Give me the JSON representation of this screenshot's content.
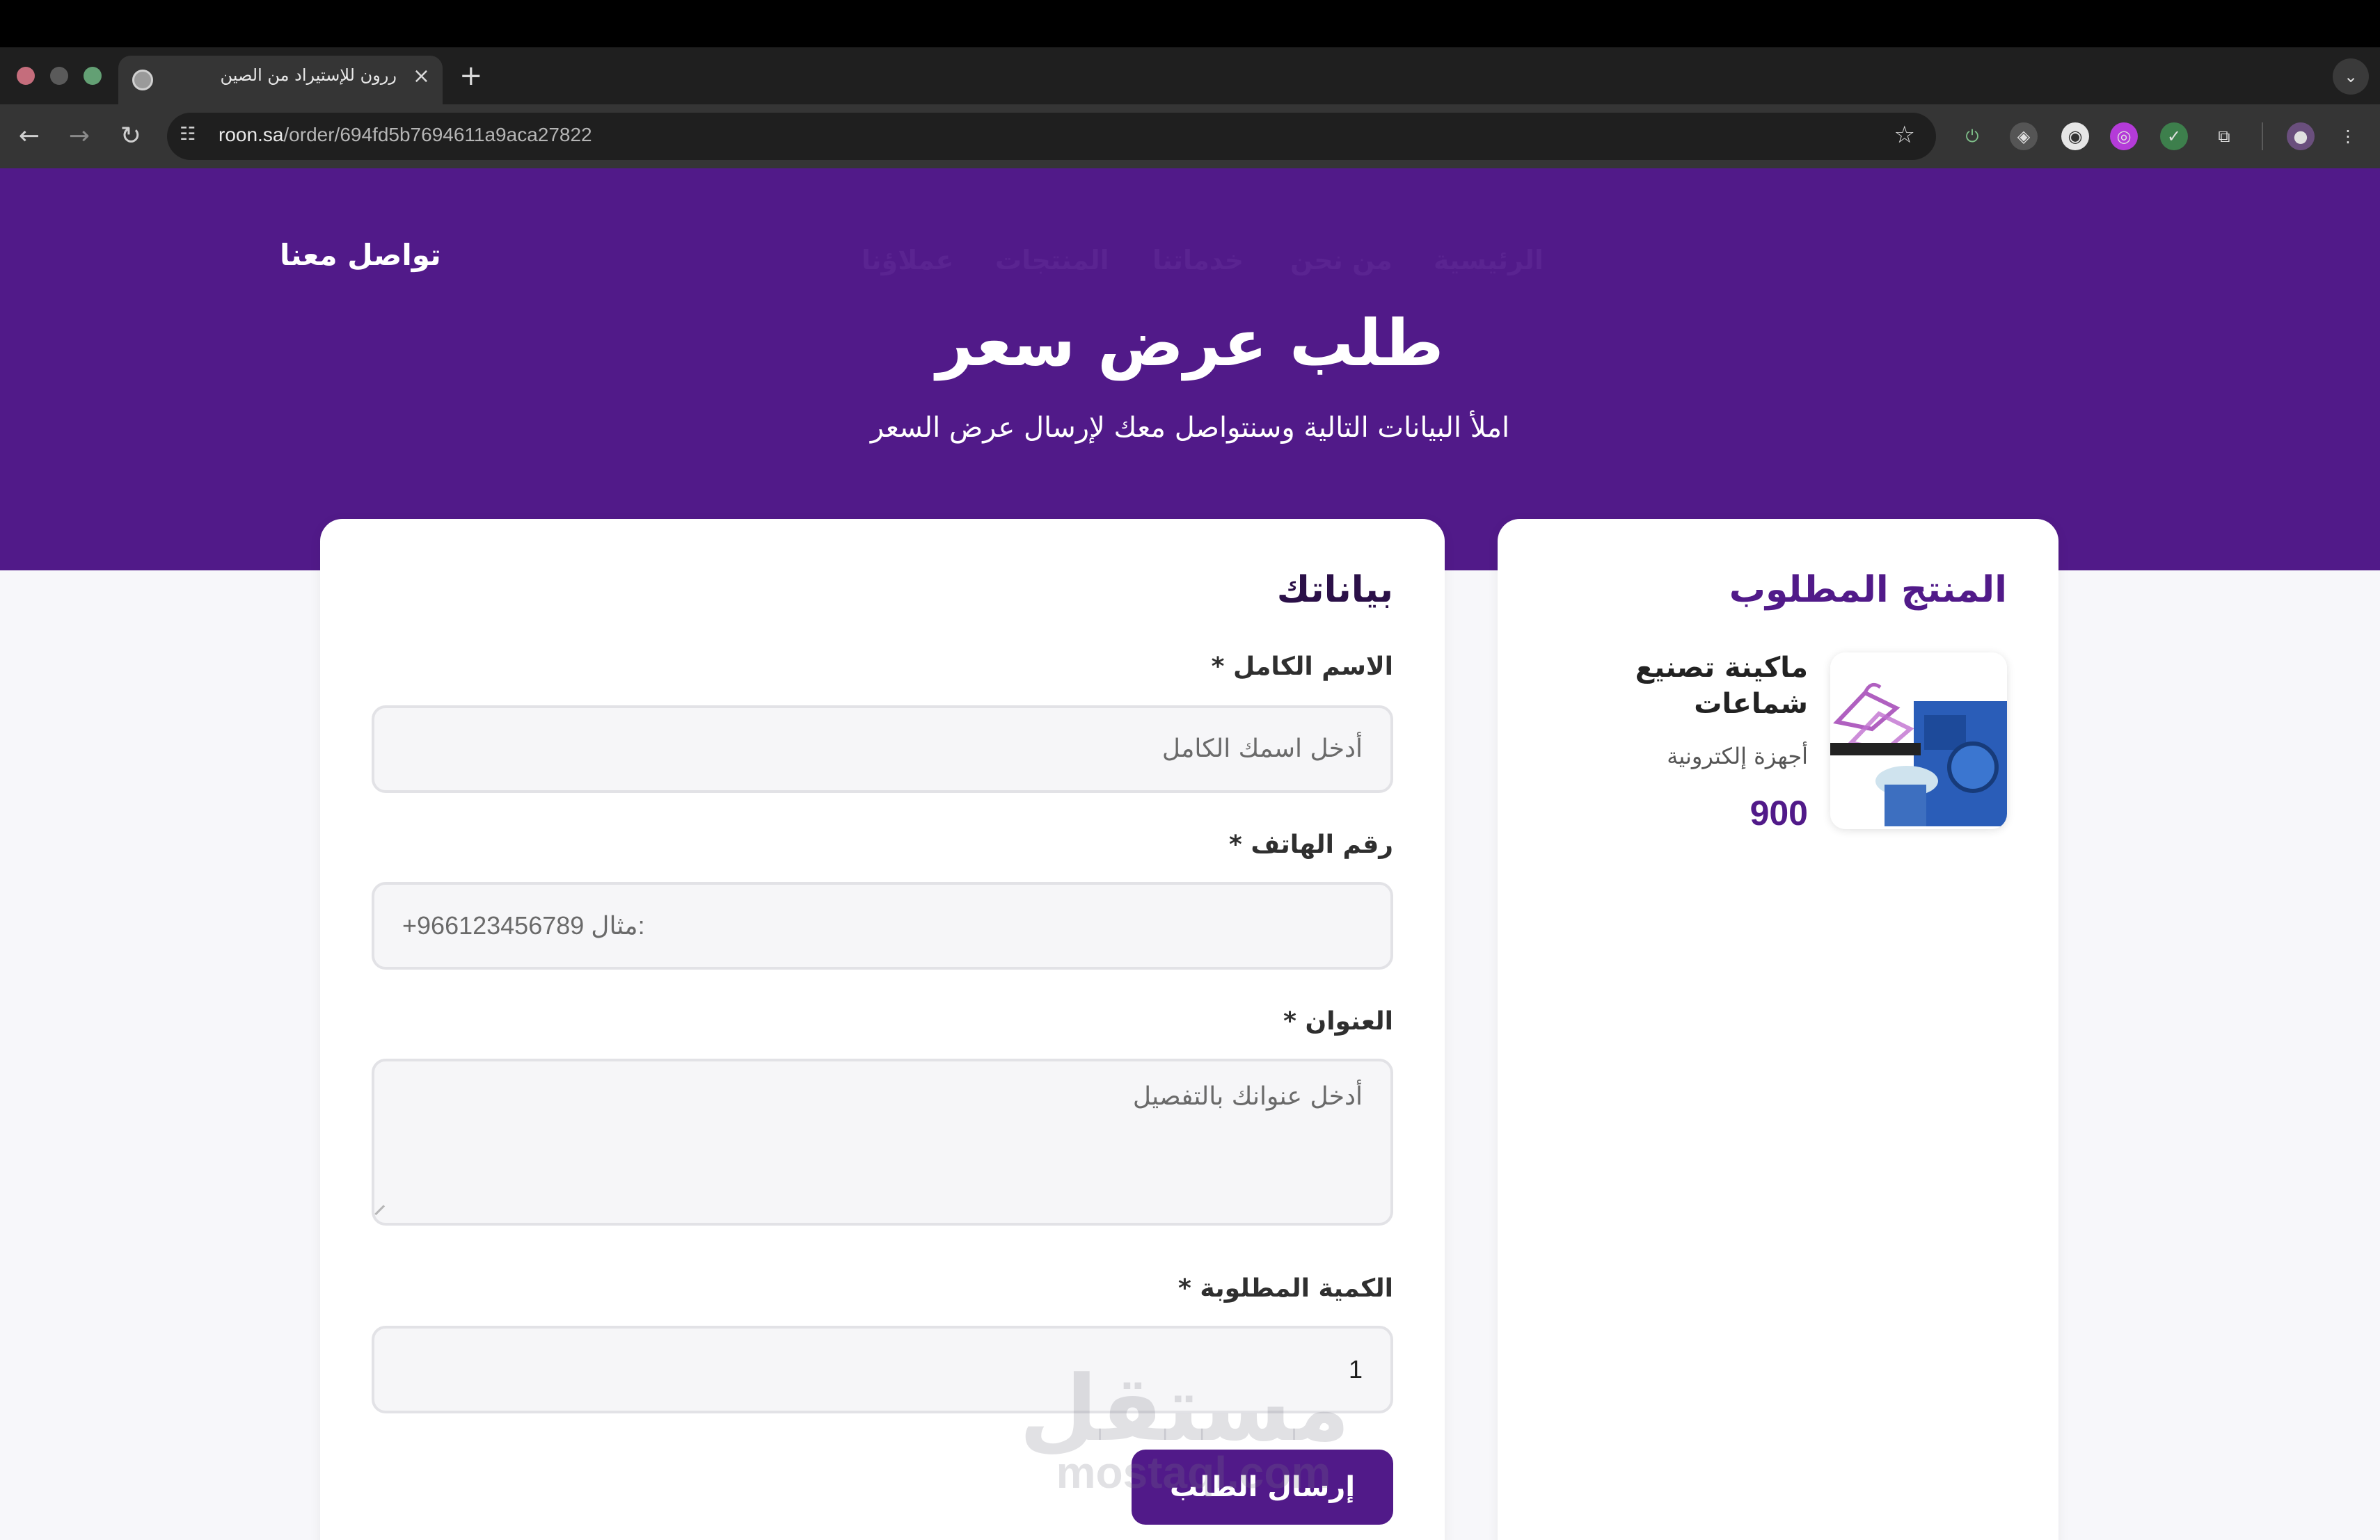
{
  "browser": {
    "tab_title": "ررون للإستيراد من الصين",
    "url_domain": "roon.sa",
    "url_path": "/order/694fd5b7694611a9aca27822"
  },
  "nav": {
    "links": [
      "الرئيسية",
      "من نحن",
      "خدماتنا",
      "المنتجات",
      "عملاؤنا"
    ],
    "contact": "تواصل معنا"
  },
  "hero": {
    "title": "طلب عرض سعر",
    "subtitle": "املأ البيانات التالية وسنتواصل معك لإرسال عرض السعر"
  },
  "form": {
    "title": "بياناتك",
    "name_label": "الاسم الكامل *",
    "name_placeholder": "أدخل اسمك الكامل",
    "phone_label": "رقم الهاتف *",
    "phone_placeholder_prefix": "مثال:",
    "phone_placeholder_number": "+966123456789",
    "address_label": "العنوان *",
    "address_placeholder": "أدخل عنوانك بالتفصيل",
    "quantity_label": "الكمية المطلوبة *",
    "quantity_value": "1",
    "submit_label": "إرسال الطلب"
  },
  "product": {
    "section_title": "المنتج المطلوب",
    "name": "ماكينة تصنيع شماعات",
    "category": "أجهزة إلكترونية",
    "price": "900"
  },
  "watermark": {
    "arabic": "مستقل",
    "latin": "mostaql.com"
  },
  "colors": {
    "brand": "#511a89",
    "header_bg": "#511a89",
    "page_bg": "#f7f7fa"
  }
}
